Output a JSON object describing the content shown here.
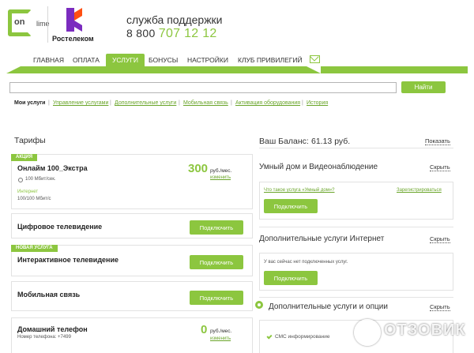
{
  "header": {
    "onlime_logo": {
      "text_on": "on",
      "text_lime": "lime"
    },
    "rostelecom_logo": {
      "name": "Ростелеком"
    },
    "support_title": "служба поддержки",
    "support_phone_prefix": "8 800",
    "support_phone_number": "707 12 12"
  },
  "nav": {
    "items": [
      {
        "label": "ГЛАВНАЯ"
      },
      {
        "label": "ОПЛАТА"
      },
      {
        "label": "УСЛУГИ"
      },
      {
        "label": "БОНУСЫ"
      },
      {
        "label": "НАСТРОЙКИ"
      },
      {
        "label": "КЛУБ ПРИВИЛЕГИЙ"
      }
    ],
    "active_index": 2,
    "mail_icon": "mail-icon"
  },
  "search": {
    "value": "",
    "button_label": "Найти"
  },
  "subnav": {
    "items": [
      {
        "label": "Мои услуги"
      },
      {
        "label": "Управление услугами"
      },
      {
        "label": "Дополнительные услуги"
      },
      {
        "label": "Мобильная связь"
      },
      {
        "label": "Активация оборудования"
      },
      {
        "label": "История"
      }
    ]
  },
  "tariffs": {
    "title": "Тарифы",
    "internet": {
      "badge": "АКЦИЯ",
      "name": "Онлайм 100_Экстра",
      "speed": "100 Мбит/сек.",
      "label": "Интернет",
      "detail": "100/100 Мбит/с",
      "price": "300",
      "price_unit": "руб./мес.",
      "change_link": "изменить"
    },
    "tv": {
      "name": "Цифровое телевидение",
      "button": "Подключить"
    },
    "interactive": {
      "badge": "НОВАЯ УСЛУГА",
      "name": "Интерактивное телевидение",
      "button": "Подключить"
    },
    "mobile": {
      "name": "Мобильная связь",
      "button": "Подключить"
    },
    "phone": {
      "name": "Домашний телефон",
      "number": "Номер телефона: +7499",
      "price": "0",
      "price_unit": "руб./мес.",
      "change_link": "изменить"
    }
  },
  "right": {
    "balance_label": "Ваш Баланс:",
    "balance_value": "61.13 руб.",
    "show_link": "Показать",
    "smart_home": {
      "title": "Умный дом и Видеонаблюдение",
      "expand": "Скрыть",
      "what_link": "Что такое услуга «Умный дом»?",
      "register_link": "Зарегистрироваться",
      "button": "Подключить"
    },
    "extra_internet": {
      "title": "Дополнительные услуги Интернет",
      "expand": "Скрыть",
      "message": "У вас сейчас нет подключенных услуг.",
      "button": "Подключить"
    },
    "extra_options": {
      "title": "Дополнительные услуги и опции",
      "expand": "Скрыть",
      "item": "СМС информирование"
    }
  },
  "watermark": {
    "text": "ОТЗОВИК"
  },
  "colors": {
    "accent": "#8cc63f",
    "link": "#6aa52a"
  }
}
